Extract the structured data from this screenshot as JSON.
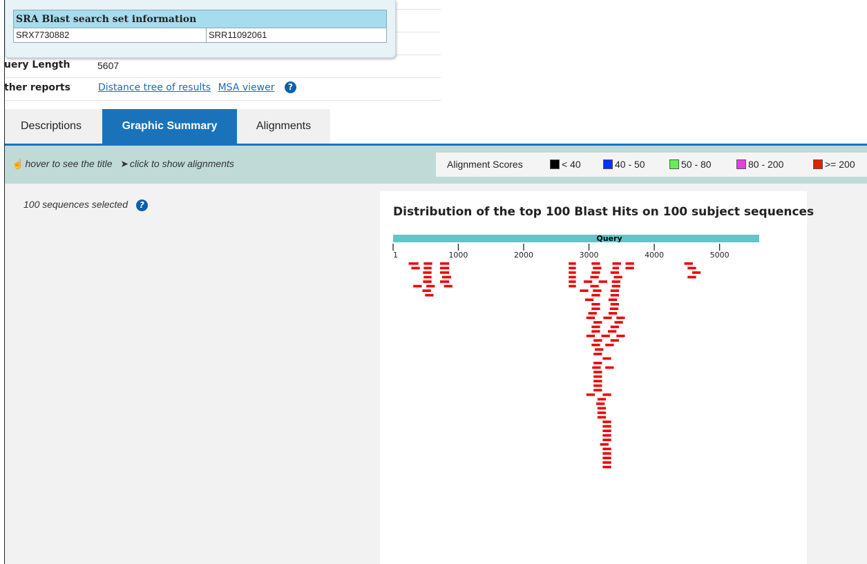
{
  "popup": {
    "title": "SRA Blast search set information",
    "experiment": "SRX7730882",
    "run": "SRR11092061"
  },
  "info": {
    "query_length_label": "uery Length",
    "query_length_value": "5607",
    "other_reports_label": "ther reports",
    "link_distance_tree": "Distance tree of results",
    "link_msa_viewer": "MSA viewer"
  },
  "tabs": [
    {
      "label": "Descriptions",
      "active": false
    },
    {
      "label": "Graphic Summary",
      "active": true
    },
    {
      "label": "Alignments",
      "active": false
    }
  ],
  "toolbar": {
    "hover_hint": "hover to see the title",
    "click_hint": "click to show alignments"
  },
  "legend": {
    "title": "Alignment Scores",
    "items": [
      {
        "label": "< 40",
        "color": "#000000"
      },
      {
        "label": "40 - 50",
        "color": "#0033ff"
      },
      {
        "label": "50 - 80",
        "color": "#66ee55"
      },
      {
        "label": "80 - 200",
        "color": "#dd44dd"
      },
      {
        "label": ">= 200",
        "color": "#dd2200"
      }
    ]
  },
  "selection": {
    "text": "100 sequences selected"
  },
  "graph": {
    "title": "Distribution of the top 100 Blast Hits on 100 subject sequences",
    "query_label": "Query",
    "query_length": 5607,
    "hit_color": "#ee0000",
    "query_color": "#5cc8c8",
    "ticks": [
      "1",
      "1000",
      "2000",
      "3000",
      "4000",
      "5000"
    ]
  },
  "chart_data": {
    "type": "bar",
    "title": "Distribution of the top 100 Blast Hits on 100 subject sequences",
    "xlabel": "Query",
    "xlim": [
      1,
      5607
    ],
    "hits": [
      {
        "start": 240,
        "end": 390
      },
      {
        "start": 470,
        "end": 600
      },
      {
        "start": 720,
        "end": 860
      },
      {
        "start": 2690,
        "end": 2800
      },
      {
        "start": 3040,
        "end": 3170
      },
      {
        "start": 3360,
        "end": 3490
      },
      {
        "start": 3560,
        "end": 3690
      },
      {
        "start": 4460,
        "end": 4590
      },
      {
        "start": 280,
        "end": 410
      },
      {
        "start": 470,
        "end": 590
      },
      {
        "start": 720,
        "end": 860
      },
      {
        "start": 2690,
        "end": 2800
      },
      {
        "start": 3060,
        "end": 3190
      },
      {
        "start": 3360,
        "end": 3460
      },
      {
        "start": 3560,
        "end": 3690
      },
      {
        "start": 4510,
        "end": 4640
      },
      {
        "start": 460,
        "end": 590
      },
      {
        "start": 720,
        "end": 860
      },
      {
        "start": 2690,
        "end": 2800
      },
      {
        "start": 3040,
        "end": 3170
      },
      {
        "start": 3330,
        "end": 3460
      },
      {
        "start": 4580,
        "end": 4710
      },
      {
        "start": 470,
        "end": 590
      },
      {
        "start": 750,
        "end": 890
      },
      {
        "start": 2690,
        "end": 2800
      },
      {
        "start": 3020,
        "end": 3150
      },
      {
        "start": 3380,
        "end": 3510
      },
      {
        "start": 4510,
        "end": 4640
      },
      {
        "start": 460,
        "end": 590
      },
      {
        "start": 720,
        "end": 860
      },
      {
        "start": 2690,
        "end": 2800
      },
      {
        "start": 2920,
        "end": 3050
      },
      {
        "start": 3150,
        "end": 3280
      },
      {
        "start": 3350,
        "end": 3480
      },
      {
        "start": 310,
        "end": 440
      },
      {
        "start": 510,
        "end": 640
      },
      {
        "start": 780,
        "end": 910
      },
      {
        "start": 2690,
        "end": 2800
      },
      {
        "start": 3020,
        "end": 3150
      },
      {
        "start": 3350,
        "end": 3480
      },
      {
        "start": 450,
        "end": 580
      },
      {
        "start": 2860,
        "end": 2990
      },
      {
        "start": 3060,
        "end": 3190
      },
      {
        "start": 3330,
        "end": 3460
      },
      {
        "start": 490,
        "end": 620
      },
      {
        "start": 3040,
        "end": 3170
      },
      {
        "start": 3330,
        "end": 3460
      },
      {
        "start": 2940,
        "end": 3070
      },
      {
        "start": 3300,
        "end": 3430
      },
      {
        "start": 3040,
        "end": 3170
      },
      {
        "start": 3330,
        "end": 3460
      },
      {
        "start": 3040,
        "end": 3170
      },
      {
        "start": 3320,
        "end": 3450
      },
      {
        "start": 2990,
        "end": 3120
      },
      {
        "start": 3300,
        "end": 3430
      },
      {
        "start": 2960,
        "end": 3090
      },
      {
        "start": 3220,
        "end": 3350
      },
      {
        "start": 3070,
        "end": 3200
      },
      {
        "start": 3390,
        "end": 3520
      },
      {
        "start": 3040,
        "end": 3170
      },
      {
        "start": 3330,
        "end": 3460
      },
      {
        "start": 3040,
        "end": 3170
      },
      {
        "start": 3290,
        "end": 3420
      },
      {
        "start": 2960,
        "end": 3090
      },
      {
        "start": 3190,
        "end": 3320
      },
      {
        "start": 3420,
        "end": 3550
      },
      {
        "start": 3070,
        "end": 3200
      },
      {
        "start": 3420,
        "end": 3550
      },
      {
        "start": 3040,
        "end": 3170
      },
      {
        "start": 3250,
        "end": 3380
      },
      {
        "start": 3090,
        "end": 3220
      },
      {
        "start": 3330,
        "end": 3460
      },
      {
        "start": 3070,
        "end": 3200
      },
      {
        "start": 3210,
        "end": 3340
      },
      {
        "start": 3070,
        "end": 3200
      },
      {
        "start": 3050,
        "end": 3180
      },
      {
        "start": 3250,
        "end": 3380
      },
      {
        "start": 3070,
        "end": 3200
      },
      {
        "start": 3070,
        "end": 3200
      },
      {
        "start": 3070,
        "end": 3200
      },
      {
        "start": 3070,
        "end": 3200
      },
      {
        "start": 3070,
        "end": 3200
      },
      {
        "start": 2960,
        "end": 3090
      },
      {
        "start": 3130,
        "end": 3260
      },
      {
        "start": 3110,
        "end": 3240
      },
      {
        "start": 3130,
        "end": 3260
      },
      {
        "start": 3130,
        "end": 3260
      },
      {
        "start": 3130,
        "end": 3260
      },
      {
        "start": 3210,
        "end": 3340
      },
      {
        "start": 3210,
        "end": 3340
      },
      {
        "start": 3210,
        "end": 3340
      },
      {
        "start": 3210,
        "end": 3340
      },
      {
        "start": 3210,
        "end": 3340
      },
      {
        "start": 3210,
        "end": 3340
      },
      {
        "start": 3170,
        "end": 3300
      },
      {
        "start": 3210,
        "end": 3340
      },
      {
        "start": 3210,
        "end": 3340
      },
      {
        "start": 3210,
        "end": 3340
      },
      {
        "start": 3210,
        "end": 3340
      },
      {
        "start": 3210,
        "end": 3340
      }
    ]
  }
}
